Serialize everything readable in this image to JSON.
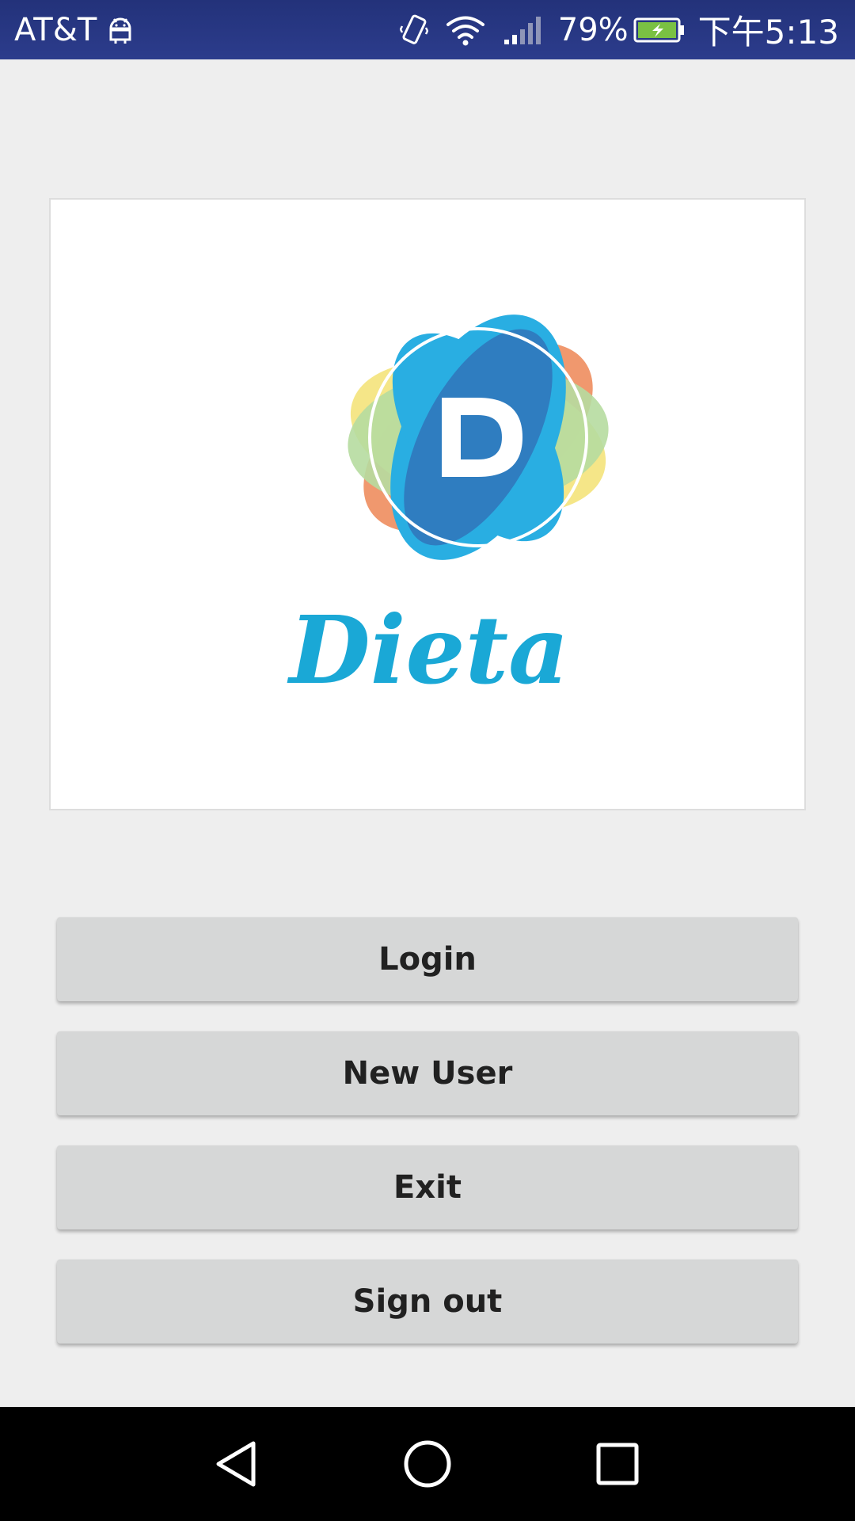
{
  "status_bar": {
    "carrier": "AT&T",
    "battery_percent": "79%",
    "time": "下午5:13",
    "icons": [
      "android-debug-icon",
      "vibrate-icon",
      "wifi-icon",
      "signal-icon",
      "battery-charging-icon"
    ]
  },
  "logo": {
    "letter": "D",
    "wordmark": "Dieta",
    "colors": {
      "blue_dark": "#2f7dc0",
      "blue_light": "#29aee2",
      "orange": "#ef9266",
      "yellow": "#f4e582",
      "green": "#b6dba0",
      "wordmark": "#1aa8d6"
    }
  },
  "buttons": {
    "login": "Login",
    "new_user": "New User",
    "exit": "Exit",
    "sign_out": "Sign out"
  },
  "nav_bar": {
    "icons": [
      "back-icon",
      "home-icon",
      "recent-apps-icon"
    ]
  }
}
